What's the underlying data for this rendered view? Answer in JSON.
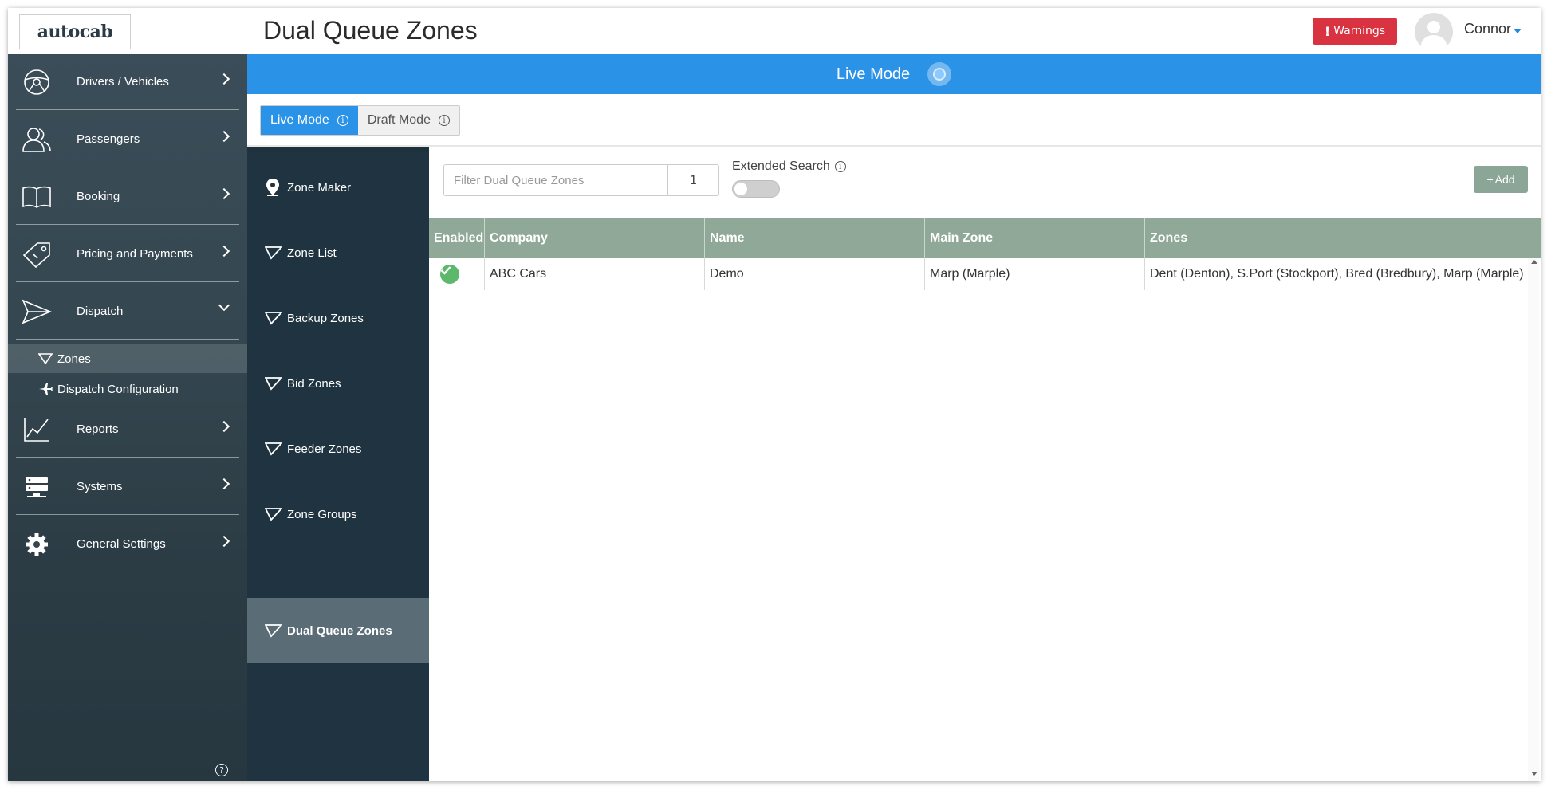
{
  "header": {
    "logo": "autocab",
    "page_title": "Dual Queue Zones",
    "warnings_label": "Warnings",
    "user_name": "Connor"
  },
  "sidebar": {
    "items": [
      {
        "label": "Drivers / Vehicles",
        "icon": "steering-wheel-icon"
      },
      {
        "label": "Passengers",
        "icon": "users-icon"
      },
      {
        "label": "Booking",
        "icon": "book-icon"
      },
      {
        "label": "Pricing and Payments",
        "icon": "price-tag-icon"
      },
      {
        "label": "Dispatch",
        "icon": "paper-plane-icon"
      },
      {
        "label": "Reports",
        "icon": "line-chart-icon"
      },
      {
        "label": "Systems",
        "icon": "server-icon"
      },
      {
        "label": "General Settings",
        "icon": "gear-icon"
      }
    ],
    "dispatch_sub": [
      {
        "label": "Zones",
        "icon": "zone-icon"
      },
      {
        "label": "Dispatch Configuration",
        "icon": "plane-icon"
      }
    ]
  },
  "banner": {
    "label": "Live Mode"
  },
  "mode_tabs": {
    "live": "Live Mode",
    "draft": "Draft Mode"
  },
  "subnav": {
    "items": [
      {
        "label": "Zone Maker"
      },
      {
        "label": "Zone List"
      },
      {
        "label": "Backup Zones"
      },
      {
        "label": "Bid Zones"
      },
      {
        "label": "Feeder Zones"
      },
      {
        "label": "Zone Groups"
      },
      {
        "label": "Dual Queue Zones"
      }
    ]
  },
  "toolbar": {
    "filter_placeholder": "Filter Dual Queue Zones",
    "page_number": "1",
    "extended_search_label": "Extended Search",
    "add_label": "Add"
  },
  "table": {
    "columns": [
      "Enabled",
      "Company",
      "Name",
      "Main Zone",
      "Zones"
    ],
    "rows": [
      {
        "company": "ABC Cars",
        "name": "Demo",
        "main_zone": "Marp (Marple)",
        "zones": "Dent (Denton), S.Port (Stockport), Bred (Bredbury), Marp (Marple)"
      }
    ]
  },
  "colors": {
    "accent": "#2a93e8",
    "warning": "#d93240",
    "table_header": "#8fa898",
    "enabled": "#5cb86a"
  }
}
